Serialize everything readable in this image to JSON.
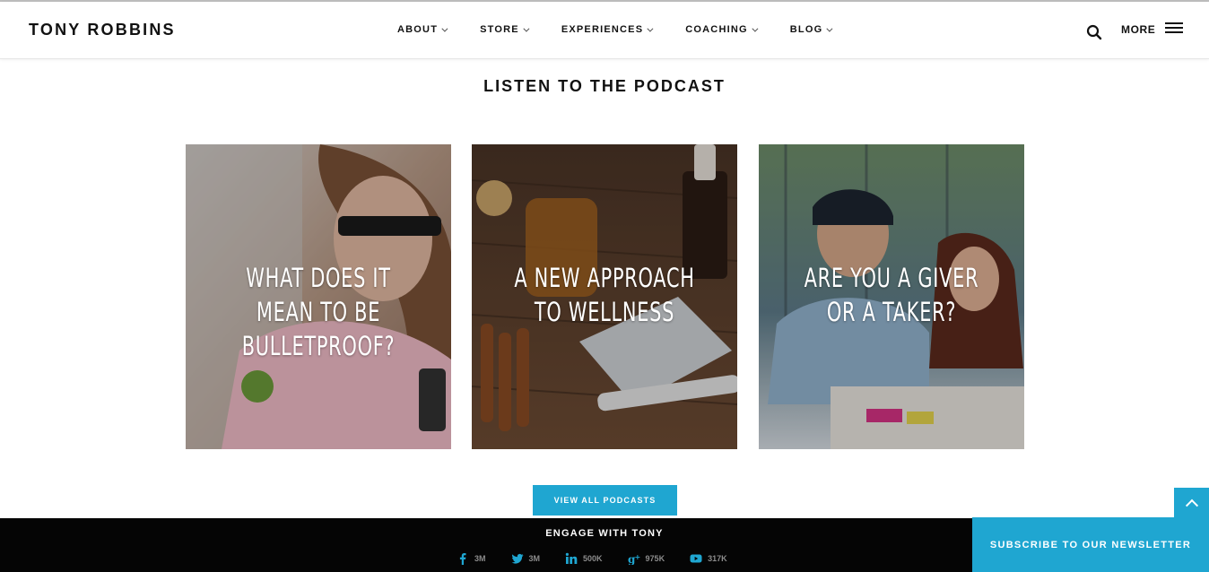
{
  "header": {
    "logo": "TONY ROBBINS",
    "nav": [
      {
        "label": "ABOUT"
      },
      {
        "label": "STORE"
      },
      {
        "label": "EXPERIENCES"
      },
      {
        "label": "COACHING"
      },
      {
        "label": "BLOG"
      }
    ],
    "more_label": "MORE"
  },
  "section": {
    "title": "LISTEN TO THE PODCAST",
    "cards": [
      {
        "title": "WHAT DOES IT MEAN TO BE BULLETPROOF?"
      },
      {
        "title": "A NEW APPROACH TO WELLNESS"
      },
      {
        "title": "ARE YOU A GIVER OR A TAKER?"
      }
    ],
    "cta_label": "VIEW ALL PODCASTS"
  },
  "footer": {
    "engage_title": "ENGAGE WITH TONY",
    "socials": [
      {
        "icon": "facebook-icon",
        "count": "3M"
      },
      {
        "icon": "twitter-icon",
        "count": "3M"
      },
      {
        "icon": "linkedin-icon",
        "count": "500K"
      },
      {
        "icon": "google-plus-icon",
        "count": "975K"
      },
      {
        "icon": "youtube-icon",
        "count": "317K"
      }
    ]
  },
  "newsletter_label": "SUBSCRIBE TO OUR NEWSLETTER",
  "colors": {
    "accent": "#1fa6d1",
    "footer_bg": "#050505"
  }
}
